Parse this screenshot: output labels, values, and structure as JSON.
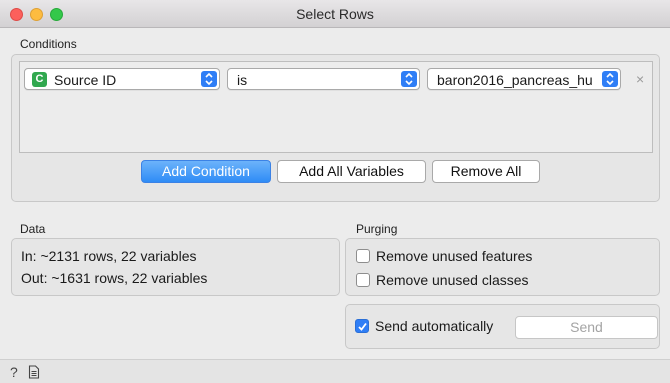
{
  "window": {
    "title": "Select Rows"
  },
  "conditions": {
    "label": "Conditions",
    "rows": [
      {
        "variable": "Source ID",
        "variable_type_badge": "C",
        "operator": "is",
        "value": "baron2016_pancreas_hu",
        "remove_symbol": "×"
      }
    ],
    "add_condition_label": "Add Condition",
    "add_all_variables_label": "Add All Variables",
    "remove_all_label": "Remove All"
  },
  "data": {
    "label": "Data",
    "in_text": "In: ~2131 rows, 22 variables",
    "out_text": "Out: ~1631 rows, 22 variables"
  },
  "purging": {
    "label": "Purging",
    "remove_unused_features": {
      "label": "Remove unused features",
      "checked": false
    },
    "remove_unused_classes": {
      "label": "Remove unused classes",
      "checked": false
    }
  },
  "commit": {
    "send_automatically": {
      "label": "Send automatically",
      "checked": true
    },
    "send_label": "Send"
  },
  "status_bar": {
    "help_icon": "question-icon",
    "report_icon": "document-icon"
  },
  "colors": {
    "accent": "#2f7ef6",
    "badge": "#31a84f",
    "close": "#fc605c",
    "minimize": "#fdbc40",
    "maximize": "#34c84a"
  }
}
